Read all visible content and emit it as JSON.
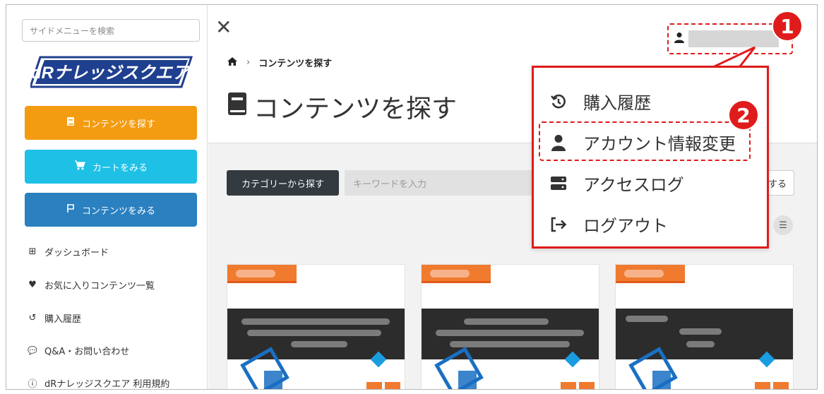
{
  "sidebar": {
    "search_placeholder": "サイドメニューを検索",
    "logo_text": "dRナレッジスクエア",
    "buttons": [
      {
        "label": "コンテンツを探す",
        "icon": "book-icon",
        "color": "#f39c12"
      },
      {
        "label": "カートをみる",
        "icon": "cart-icon",
        "color": "#1ec0e6"
      },
      {
        "label": "コンテンツをみる",
        "icon": "flag-icon",
        "color": "#2b80c0"
      }
    ],
    "items": [
      {
        "label": "ダッシュボード",
        "icon": "grid-icon",
        "glyph": "⊞"
      },
      {
        "label": "お気に入りコンテンツ一覧",
        "icon": "heart-icon",
        "glyph": "♥"
      },
      {
        "label": "購入履歴",
        "icon": "history-icon",
        "glyph": "↺"
      },
      {
        "label": "Q&A・お問い合わせ",
        "icon": "chat-icon",
        "glyph": "💬"
      },
      {
        "label": "dRナレッジスクエア 利用規約",
        "icon": "info-icon",
        "glyph": "ⓘ"
      }
    ]
  },
  "main": {
    "breadcrumb": {
      "home_icon": "home-icon",
      "separator": "›",
      "current": "コンテンツを探す"
    },
    "title": "コンテンツを探す",
    "category_button": "カテゴリーから探す",
    "keyword_placeholder": "キーワードを入力",
    "search_button_partial": "する"
  },
  "user_menu": {
    "items": [
      {
        "label": "購入履歴",
        "icon": "history-icon"
      },
      {
        "label": "アカウント情報変更",
        "icon": "user-icon"
      },
      {
        "label": "アクセスログ",
        "icon": "server-icon"
      },
      {
        "label": "ログアウト",
        "icon": "logout-icon"
      }
    ]
  },
  "annotations": {
    "step1": "1",
    "step2": "2"
  },
  "colors": {
    "highlight": "#e01b1b",
    "orange": "#f39c12",
    "cyan": "#1ec0e6",
    "blue": "#2b80c0",
    "card_badge": "#f07a2e"
  }
}
